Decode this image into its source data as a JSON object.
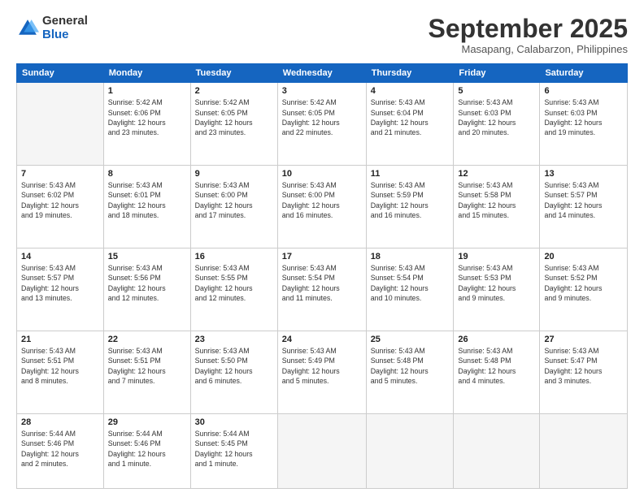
{
  "logo": {
    "line1": "General",
    "line2": "Blue"
  },
  "title": "September 2025",
  "subtitle": "Masapang, Calabarzon, Philippines",
  "weekdays": [
    "Sunday",
    "Monday",
    "Tuesday",
    "Wednesday",
    "Thursday",
    "Friday",
    "Saturday"
  ],
  "weeks": [
    [
      {
        "day": "",
        "info": ""
      },
      {
        "day": "1",
        "info": "Sunrise: 5:42 AM\nSunset: 6:06 PM\nDaylight: 12 hours\nand 23 minutes."
      },
      {
        "day": "2",
        "info": "Sunrise: 5:42 AM\nSunset: 6:05 PM\nDaylight: 12 hours\nand 23 minutes."
      },
      {
        "day": "3",
        "info": "Sunrise: 5:42 AM\nSunset: 6:05 PM\nDaylight: 12 hours\nand 22 minutes."
      },
      {
        "day": "4",
        "info": "Sunrise: 5:43 AM\nSunset: 6:04 PM\nDaylight: 12 hours\nand 21 minutes."
      },
      {
        "day": "5",
        "info": "Sunrise: 5:43 AM\nSunset: 6:03 PM\nDaylight: 12 hours\nand 20 minutes."
      },
      {
        "day": "6",
        "info": "Sunrise: 5:43 AM\nSunset: 6:03 PM\nDaylight: 12 hours\nand 19 minutes."
      }
    ],
    [
      {
        "day": "7",
        "info": "Sunrise: 5:43 AM\nSunset: 6:02 PM\nDaylight: 12 hours\nand 19 minutes."
      },
      {
        "day": "8",
        "info": "Sunrise: 5:43 AM\nSunset: 6:01 PM\nDaylight: 12 hours\nand 18 minutes."
      },
      {
        "day": "9",
        "info": "Sunrise: 5:43 AM\nSunset: 6:00 PM\nDaylight: 12 hours\nand 17 minutes."
      },
      {
        "day": "10",
        "info": "Sunrise: 5:43 AM\nSunset: 6:00 PM\nDaylight: 12 hours\nand 16 minutes."
      },
      {
        "day": "11",
        "info": "Sunrise: 5:43 AM\nSunset: 5:59 PM\nDaylight: 12 hours\nand 16 minutes."
      },
      {
        "day": "12",
        "info": "Sunrise: 5:43 AM\nSunset: 5:58 PM\nDaylight: 12 hours\nand 15 minutes."
      },
      {
        "day": "13",
        "info": "Sunrise: 5:43 AM\nSunset: 5:57 PM\nDaylight: 12 hours\nand 14 minutes."
      }
    ],
    [
      {
        "day": "14",
        "info": "Sunrise: 5:43 AM\nSunset: 5:57 PM\nDaylight: 12 hours\nand 13 minutes."
      },
      {
        "day": "15",
        "info": "Sunrise: 5:43 AM\nSunset: 5:56 PM\nDaylight: 12 hours\nand 12 minutes."
      },
      {
        "day": "16",
        "info": "Sunrise: 5:43 AM\nSunset: 5:55 PM\nDaylight: 12 hours\nand 12 minutes."
      },
      {
        "day": "17",
        "info": "Sunrise: 5:43 AM\nSunset: 5:54 PM\nDaylight: 12 hours\nand 11 minutes."
      },
      {
        "day": "18",
        "info": "Sunrise: 5:43 AM\nSunset: 5:54 PM\nDaylight: 12 hours\nand 10 minutes."
      },
      {
        "day": "19",
        "info": "Sunrise: 5:43 AM\nSunset: 5:53 PM\nDaylight: 12 hours\nand 9 minutes."
      },
      {
        "day": "20",
        "info": "Sunrise: 5:43 AM\nSunset: 5:52 PM\nDaylight: 12 hours\nand 9 minutes."
      }
    ],
    [
      {
        "day": "21",
        "info": "Sunrise: 5:43 AM\nSunset: 5:51 PM\nDaylight: 12 hours\nand 8 minutes."
      },
      {
        "day": "22",
        "info": "Sunrise: 5:43 AM\nSunset: 5:51 PM\nDaylight: 12 hours\nand 7 minutes."
      },
      {
        "day": "23",
        "info": "Sunrise: 5:43 AM\nSunset: 5:50 PM\nDaylight: 12 hours\nand 6 minutes."
      },
      {
        "day": "24",
        "info": "Sunrise: 5:43 AM\nSunset: 5:49 PM\nDaylight: 12 hours\nand 5 minutes."
      },
      {
        "day": "25",
        "info": "Sunrise: 5:43 AM\nSunset: 5:48 PM\nDaylight: 12 hours\nand 5 minutes."
      },
      {
        "day": "26",
        "info": "Sunrise: 5:43 AM\nSunset: 5:48 PM\nDaylight: 12 hours\nand 4 minutes."
      },
      {
        "day": "27",
        "info": "Sunrise: 5:43 AM\nSunset: 5:47 PM\nDaylight: 12 hours\nand 3 minutes."
      }
    ],
    [
      {
        "day": "28",
        "info": "Sunrise: 5:44 AM\nSunset: 5:46 PM\nDaylight: 12 hours\nand 2 minutes."
      },
      {
        "day": "29",
        "info": "Sunrise: 5:44 AM\nSunset: 5:46 PM\nDaylight: 12 hours\nand 1 minute."
      },
      {
        "day": "30",
        "info": "Sunrise: 5:44 AM\nSunset: 5:45 PM\nDaylight: 12 hours\nand 1 minute."
      },
      {
        "day": "",
        "info": ""
      },
      {
        "day": "",
        "info": ""
      },
      {
        "day": "",
        "info": ""
      },
      {
        "day": "",
        "info": ""
      }
    ]
  ]
}
